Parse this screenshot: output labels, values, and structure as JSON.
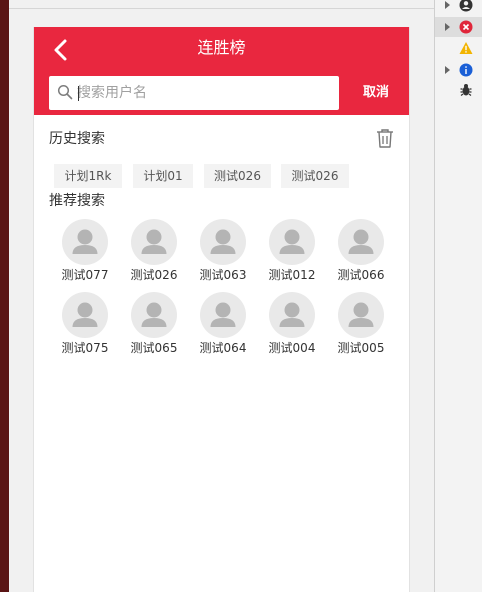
{
  "header": {
    "title": "连胜榜",
    "back_icon": "chevron-left-icon"
  },
  "search": {
    "placeholder": "搜索用户名",
    "value": "",
    "cancel_label": "取消"
  },
  "history": {
    "title": "历史搜索",
    "tags": [
      "计划1Rk",
      "计划01",
      "测试026",
      "测试026"
    ]
  },
  "recommend": {
    "title": "推荐搜索",
    "users": [
      {
        "name": "测试077"
      },
      {
        "name": "测试026"
      },
      {
        "name": "测试063"
      },
      {
        "name": "测试012"
      },
      {
        "name": "测试066"
      },
      {
        "name": "测试075"
      },
      {
        "name": "测试065"
      },
      {
        "name": "测试064"
      },
      {
        "name": "测试004"
      },
      {
        "name": "测试005"
      }
    ]
  },
  "colors": {
    "brand": "#e9273f",
    "tag_bg": "#f3f3f3",
    "avatar_bg": "#e9e9e9"
  },
  "devtools": {
    "rows": [
      {
        "icon": "user-icon"
      },
      {
        "icon": "error-icon"
      },
      {
        "icon": "warning-icon"
      },
      {
        "icon": "info-icon"
      },
      {
        "icon": "bug-icon"
      }
    ]
  }
}
